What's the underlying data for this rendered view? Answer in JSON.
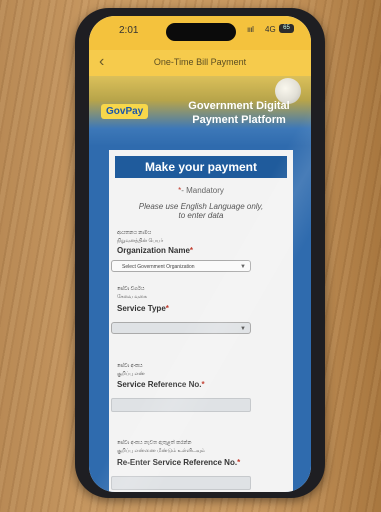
{
  "status": {
    "time": "2:01",
    "signal": "ıııl",
    "network": "4G",
    "battery": "65"
  },
  "nav": {
    "back_glyph": "‹",
    "title": "One-Time Bill Payment"
  },
  "banner": {
    "logo": "GovPay",
    "title_line1": "Government Digital",
    "title_line2": "Payment Platform"
  },
  "form": {
    "heading": "Make your payment",
    "mandatory_star": "*",
    "mandatory_text": "- Mandatory",
    "instruction_line1": "Please use English Language only,",
    "instruction_line2": "to enter data",
    "organization": {
      "sinhala": "ආයතනය නාමය",
      "tamil": "நிறுவனத்தின் பெயர்",
      "label": "Organization Name",
      "required": "*",
      "selected": "Select Government Organization"
    },
    "service_type": {
      "sinhala": "සේවා වර්ගය",
      "tamil": "சேவை வகை",
      "label": "Service Type",
      "required": "*",
      "selected": ""
    },
    "service_ref": {
      "sinhala": "සේවා අංකය",
      "tamil": "குறிப்பு எண்",
      "label": "Service Reference No.",
      "required": "*",
      "value": ""
    },
    "reenter_ref": {
      "sinhala": "සේවා අංකය නැවත ඇතුළත් කරන්න",
      "tamil": "குறிப்பு எண்ணை மீண்டும் உள்ளிடவும்",
      "label": "Re-Enter Service Reference No.",
      "required": "*",
      "value": ""
    }
  },
  "icons": {
    "back": "chevron-left-icon",
    "dropdown": "chevron-down-icon",
    "assistive_touch": "assistive-touch-icon"
  },
  "colors": {
    "header_yellow": "#f6cb4c",
    "brand_blue": "#1f5b9c",
    "page_blue": "#2f6bae",
    "required_red": "#c0392b"
  }
}
